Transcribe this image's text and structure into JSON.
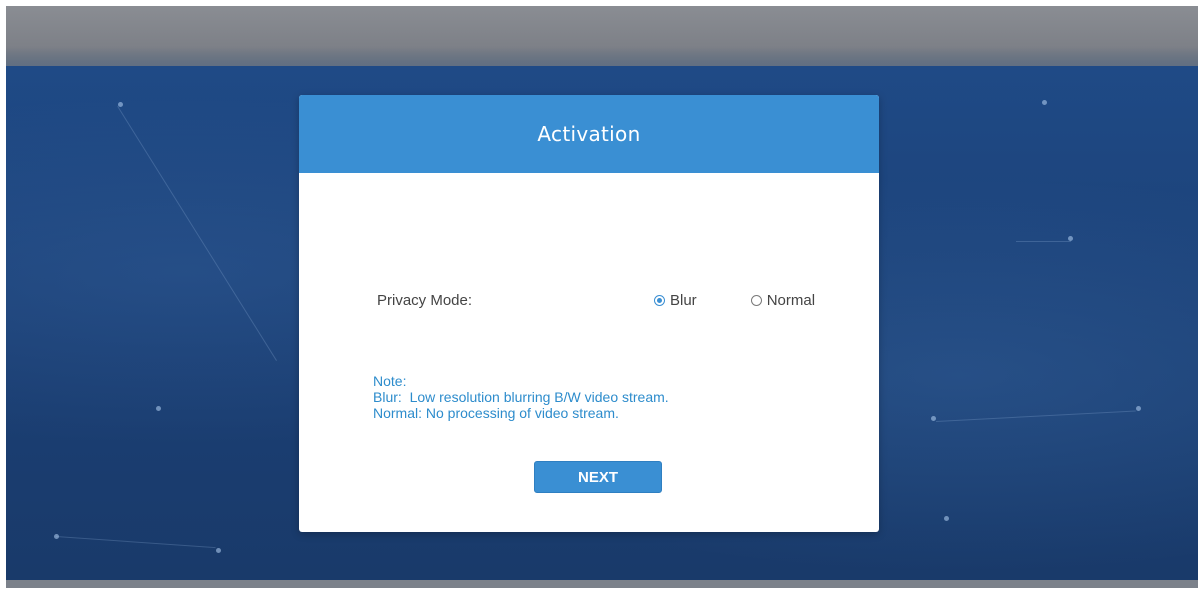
{
  "dialog": {
    "title": "Activation",
    "privacy_mode": {
      "label": "Privacy Mode:",
      "options": [
        {
          "label": "Blur",
          "selected": true
        },
        {
          "label": "Normal",
          "selected": false
        }
      ]
    },
    "note": {
      "heading": "Note:",
      "lines": [
        "Blur:  Low resolution blurring B/W video stream.",
        "Normal: No processing of video stream."
      ]
    },
    "next_label": "NEXT"
  },
  "colors": {
    "accent": "#3a8fd3",
    "note_text": "#2d8ccc",
    "background": "#1f4a86"
  }
}
